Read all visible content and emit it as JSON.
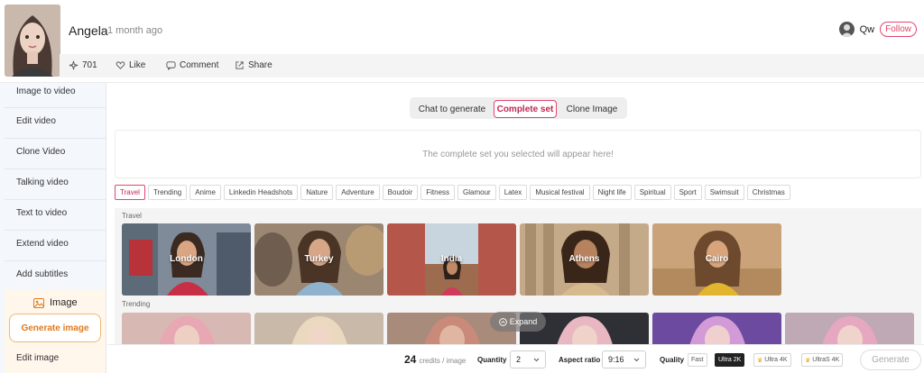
{
  "post": {
    "author": "Angela",
    "time": "1 month ago",
    "count": "701",
    "like_label": "Like",
    "comment_label": "Comment",
    "share_label": "Share"
  },
  "user": {
    "name": "Qw",
    "follow_label": "Follow"
  },
  "sidebar": {
    "items": [
      {
        "label": "Image to video"
      },
      {
        "label": "Edit video"
      },
      {
        "label": "Clone Video"
      },
      {
        "label": "Talking video"
      },
      {
        "label": "Text to video"
      },
      {
        "label": "Extend video"
      },
      {
        "label": "Add subtitles"
      }
    ],
    "image_section": {
      "title": "Image",
      "generate_label": "Generate image",
      "edit_label": "Edit image"
    }
  },
  "mode_tabs": [
    {
      "label": "Chat to generate"
    },
    {
      "label": "Complete set"
    },
    {
      "label": "Clone Image"
    }
  ],
  "placeholder_text": "The complete set you selected will appear here!",
  "categories": [
    "Travel",
    "Trending",
    "Anime",
    "Linkedin Headshots",
    "Nature",
    "Adventure",
    "Boudoir",
    "Fitness",
    "Glamour",
    "Latex",
    "Musical festival",
    "Night life",
    "Spiritual",
    "Sport",
    "Swimsuit",
    "Christmas"
  ],
  "gallery": {
    "travel_label": "Travel",
    "trending_label": "Trending",
    "travel_cards": [
      {
        "label": "London"
      },
      {
        "label": "Turkey"
      },
      {
        "label": "India"
      },
      {
        "label": "Athens"
      },
      {
        "label": "Cairo"
      }
    ],
    "expand_label": "Expand"
  },
  "bottom": {
    "credits_value": "24",
    "credits_unit": "credits / image",
    "quantity_label": "Quantity",
    "quantity_value": "2",
    "aspect_label": "Aspect ratio",
    "aspect_value": "9:16",
    "quality_label": "Quality",
    "quality_options": [
      "Fast",
      "Ultra 2K",
      "Ultra 4K",
      "UltraS 4K"
    ],
    "generate_label": "Generate"
  },
  "colors": {
    "accent": "#e0466e",
    "sidebar_bg": "#f4f8fd",
    "image_section_bg": "#fff7ec",
    "generate_accent": "#e07a1f"
  }
}
